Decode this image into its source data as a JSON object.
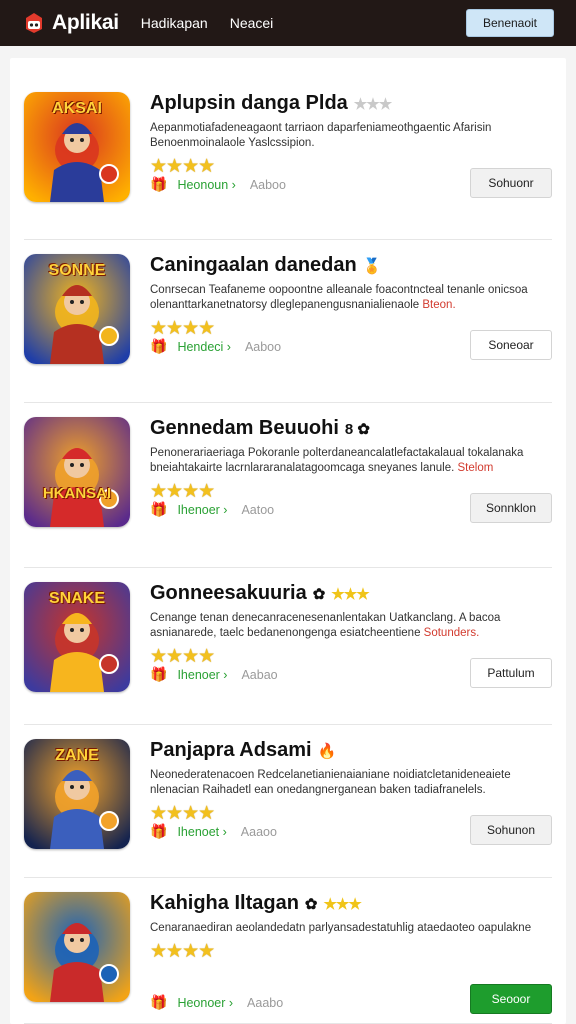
{
  "header": {
    "brand": "Aplikai",
    "nav": [
      "Hadikapan",
      "Neacei"
    ],
    "button": "Benenaoit"
  },
  "apps": [
    {
      "title": "Aplupsin danga Plda",
      "desc": "Aepanmotiafadeneagaont tarriaon daparfeniameothgaentic Afarisin Benoenmoinalaole Yaslcssipion.",
      "desc_hl": "",
      "rating": 4,
      "badge": "",
      "title_stars": "★★★",
      "meta_label": "Heonoun",
      "meta_grey": "Aaboo",
      "button": "Sohuonr",
      "button_style": "grey",
      "icon_text": "AKSAI",
      "icon_colors": [
        "#ffb000",
        "#d9361f",
        "#2a3c9a"
      ]
    },
    {
      "title": "Caningaalan danedan",
      "desc": "Conrsecan Teafaneme oopoontne alleanale foacontncteal tenanle onicsoa olenanttarkanetnatorsy dleglepanengusnanialienaole",
      "desc_hl": "Bteon.",
      "rating": 4,
      "badge": "🏅",
      "title_stars": "",
      "meta_label": "Hendeci",
      "meta_grey": "Aaboo",
      "button": "Soneoar",
      "button_style": "white",
      "icon_text": "SONNE",
      "icon_colors": [
        "#1f3ea8",
        "#f2b51d",
        "#b53021"
      ]
    },
    {
      "title": "Gennedam Beuuohi",
      "desc": "Penonerariaeriaga Pokoranle polterdaneancalatlefactakalaual tokalanaka bneiahtakairte lacrnlararanalatagoomcaga sneyanes lanule.",
      "desc_hl": "Stelom",
      "rating": 4,
      "badge": "8 ✿",
      "title_stars": "",
      "meta_label": "Ihenoer",
      "meta_grey": "Aatoo",
      "button": "Sonnklon",
      "button_style": "grey",
      "icon_text": "HKANSAI",
      "icon_colors": [
        "#5a2a8c",
        "#f0a12a",
        "#d52a2a"
      ]
    },
    {
      "title": "Gonneesakuuria",
      "desc": "Cenange tenan denecanracenesenanlentakan Uatkanclang. A bacoa asnianarede, taelc bedanenongenga esiatcheentiene",
      "desc_hl": "Sotunders.",
      "rating": 4,
      "badge": "✿",
      "title_stars": "★★★",
      "meta_label": "Ihenoer",
      "meta_grey": "Aabao",
      "button": "Pattulum",
      "button_style": "white",
      "icon_text": "SNAKE",
      "icon_colors": [
        "#3d3a9e",
        "#c7352a",
        "#f7b51e"
      ]
    },
    {
      "title": "Panjapra Adsami",
      "desc": "Neonederatenacoen Redcelanetianienaianiane noidiatcletanideneaiete nlenacian Raihadetl ean onedangnerganean baken tadiafranelels.",
      "desc_hl": "",
      "rating": 4,
      "badge": "🔥",
      "title_stars": "",
      "meta_label": "Ihenoet",
      "meta_grey": "Aaaoo",
      "button": "Sohunon",
      "button_style": "grey",
      "icon_text": "ZANE",
      "icon_colors": [
        "#14234f",
        "#f2a22a",
        "#3b5fbd"
      ]
    },
    {
      "title": "Kahigha Iltagan",
      "desc": "Cenaranaediran aeolandedatn parlyansadestatuhlig ataedaoteo oapulakne",
      "desc_hl": "",
      "rating": 4,
      "badge": "✿",
      "title_stars": "★★★",
      "meta_label": "Heonoer",
      "meta_grey": "Aaabo",
      "button": "Seooor",
      "button_style": "green",
      "icon_text": "",
      "icon_colors": [
        "#f2a316",
        "#1d63b7",
        "#c92a2a"
      ]
    }
  ]
}
